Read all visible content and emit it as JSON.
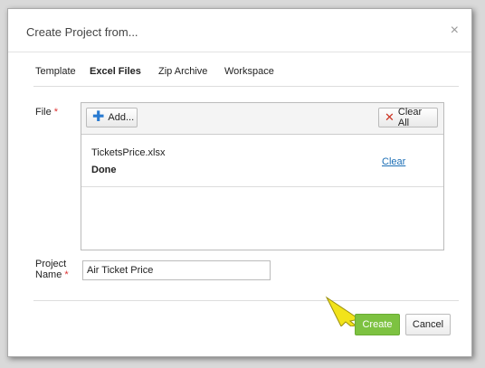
{
  "dialog": {
    "title": "Create Project from...",
    "close_glyph": "×"
  },
  "tabs": [
    {
      "label": "Template",
      "active": false
    },
    {
      "label": "Excel Files",
      "active": true
    },
    {
      "label": "Zip Archive",
      "active": false
    },
    {
      "label": "Workspace",
      "active": false
    }
  ],
  "file_section": {
    "label": "File",
    "required_mark": "*",
    "add_button": "Add...",
    "clear_all_button": "Clear All",
    "files": [
      {
        "name": "TicketsPrice.xlsx",
        "status": "Done",
        "clear_link": "Clear"
      }
    ]
  },
  "project_name": {
    "label_line1": "Project",
    "label_line2": "Name",
    "required_mark": "*",
    "value": "Air Ticket Price"
  },
  "footer": {
    "create_button": "Create",
    "cancel_button": "Cancel"
  },
  "colors": {
    "create_button_bg": "#7dc241",
    "link": "#1b6eb5",
    "required": "#d33333",
    "pointer": "#f2e31a"
  },
  "icons": {
    "add": "plus-icon",
    "clear_all": "x-icon",
    "close": "close-icon",
    "pointer": "arrow-pointer-icon"
  }
}
